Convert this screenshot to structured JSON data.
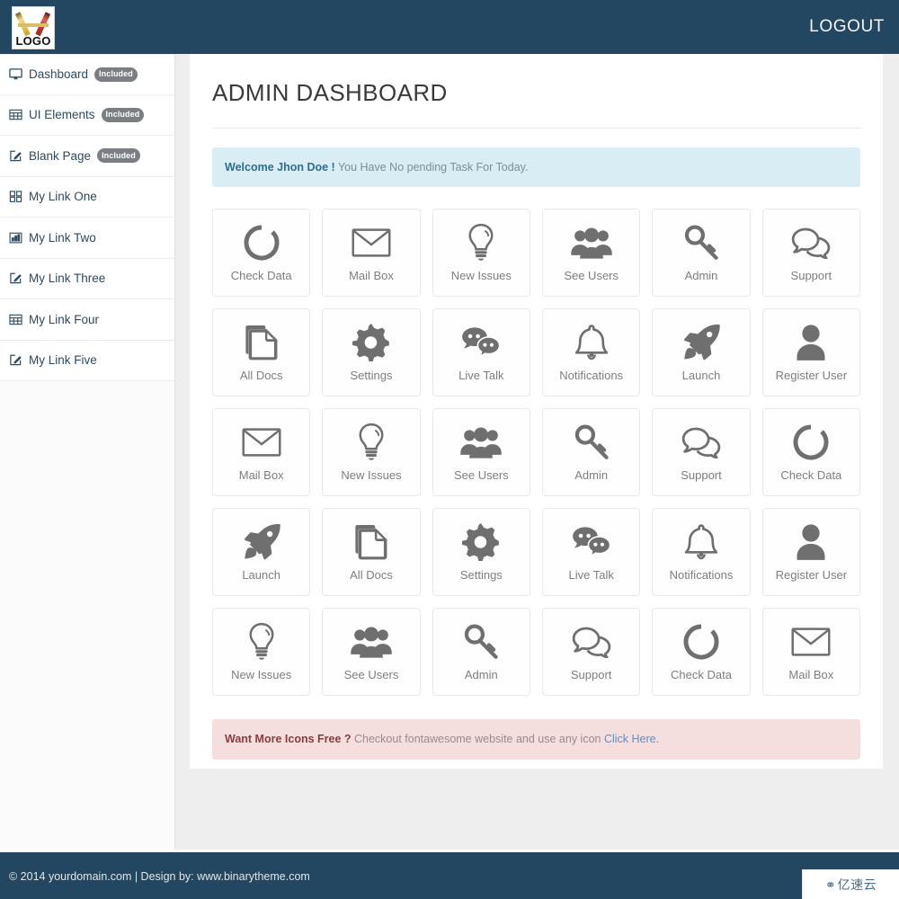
{
  "topbar": {
    "logo_text": "LOGO",
    "logo_icon": "crossed-pencils-logo",
    "logout_label": "LOGOUT"
  },
  "sidebar": {
    "items": [
      {
        "label": "Dashboard",
        "icon": "desktop-icon",
        "badge": "Included"
      },
      {
        "label": "UI Elements",
        "icon": "table-icon",
        "badge": "Included"
      },
      {
        "label": "Blank Page",
        "icon": "edit-icon",
        "badge": "Included"
      },
      {
        "label": "My Link One",
        "icon": "th-large-icon",
        "badge": ""
      },
      {
        "label": "My Link Two",
        "icon": "bar-chart-icon",
        "badge": ""
      },
      {
        "label": "My Link Three",
        "icon": "edit-icon",
        "badge": ""
      },
      {
        "label": "My Link Four",
        "icon": "table-icon",
        "badge": ""
      },
      {
        "label": "My Link Five",
        "icon": "edit-icon",
        "badge": ""
      }
    ]
  },
  "main": {
    "page_title": "ADMIN DASHBOARD",
    "welcome_alert": {
      "strong": "Welcome Jhon Doe !",
      "text": " You Have No pending Task For Today."
    },
    "icons_alert": {
      "strong": "Want More Icons Free ?",
      "text": " Checkout fontawesome website and use any icon ",
      "link": "Click Here."
    },
    "tiles": [
      {
        "label": "Check Data",
        "icon": "circle-notch-icon"
      },
      {
        "label": "Mail Box",
        "icon": "envelope-icon"
      },
      {
        "label": "New Issues",
        "icon": "lightbulb-icon"
      },
      {
        "label": "See Users",
        "icon": "users-icon"
      },
      {
        "label": "Admin",
        "icon": "key-icon"
      },
      {
        "label": "Support",
        "icon": "comments-icon"
      },
      {
        "label": "All Docs",
        "icon": "copy-icon"
      },
      {
        "label": "Settings",
        "icon": "gear-icon"
      },
      {
        "label": "Live Talk",
        "icon": "comments-filled-icon"
      },
      {
        "label": "Notifications",
        "icon": "bell-icon"
      },
      {
        "label": "Launch",
        "icon": "rocket-icon"
      },
      {
        "label": "Register User",
        "icon": "user-icon"
      },
      {
        "label": "Mail Box",
        "icon": "envelope-icon"
      },
      {
        "label": "New Issues",
        "icon": "lightbulb-icon"
      },
      {
        "label": "See Users",
        "icon": "users-icon"
      },
      {
        "label": "Admin",
        "icon": "key-icon"
      },
      {
        "label": "Support",
        "icon": "comments-icon"
      },
      {
        "label": "Check Data",
        "icon": "circle-notch-icon"
      },
      {
        "label": "Launch",
        "icon": "rocket-icon"
      },
      {
        "label": "All Docs",
        "icon": "copy-icon"
      },
      {
        "label": "Settings",
        "icon": "gear-icon"
      },
      {
        "label": "Live Talk",
        "icon": "comments-filled-icon"
      },
      {
        "label": "Notifications",
        "icon": "bell-icon"
      },
      {
        "label": "Register User",
        "icon": "user-icon"
      },
      {
        "label": "New Issues",
        "icon": "lightbulb-icon"
      },
      {
        "label": "See Users",
        "icon": "users-icon"
      },
      {
        "label": "Admin",
        "icon": "key-icon"
      },
      {
        "label": "Support",
        "icon": "comments-icon"
      },
      {
        "label": "Check Data",
        "icon": "circle-notch-icon"
      },
      {
        "label": "Mail Box",
        "icon": "envelope-icon"
      }
    ]
  },
  "footer": {
    "text": "© 2014 yourdomain.com  |  Design by: www.binarytheme.com",
    "watermark": "亿速云",
    "watermark_icon": "cloud-logo-icon"
  },
  "colors": {
    "navy": "#234761",
    "info_bg": "#d9edf5",
    "info_strong": "#2d6e8e",
    "danger_bg": "#f4dede",
    "danger_strong": "#8a3c3c",
    "link": "#5b8fc9",
    "icon_grey": "#6f6f6f",
    "badge_grey": "#7b7f83",
    "page_bg": "#eeeeee"
  }
}
